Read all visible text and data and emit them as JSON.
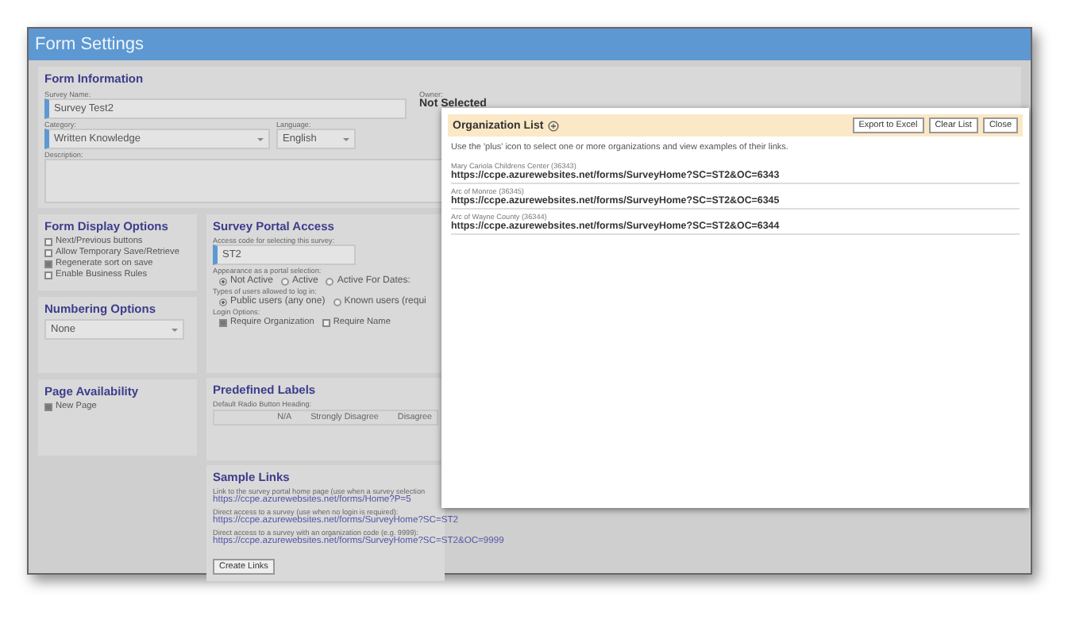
{
  "window": {
    "title": "Form Settings"
  },
  "form_information": {
    "heading": "Form Information",
    "survey_name": {
      "label": "Survey Name:",
      "value": "Survey Test2"
    },
    "owner": {
      "label": "Owner:",
      "value": "Not Selected"
    },
    "category": {
      "label": "Category:",
      "value": "Written Knowledge"
    },
    "language": {
      "label": "Language:",
      "value": "English"
    },
    "description": {
      "label": "Description:"
    }
  },
  "form_display_options": {
    "heading": "Form Display Options",
    "options": [
      {
        "label": "Next/Previous buttons",
        "checked": false
      },
      {
        "label": "Allow Temporary Save/Retrieve",
        "checked": false
      },
      {
        "label": "Regenerate sort on save",
        "checked": true
      },
      {
        "label": "Enable Business Rules",
        "checked": false
      }
    ]
  },
  "numbering_options": {
    "heading": "Numbering Options",
    "value": "None"
  },
  "page_availability": {
    "heading": "Page Availability",
    "options": [
      {
        "label": "New Page",
        "checked": true
      }
    ]
  },
  "survey_portal_access": {
    "heading": "Survey Portal Access",
    "access_code": {
      "label": "Access code for selecting this survey:",
      "value": "ST2"
    },
    "appearance": {
      "label": "Appearance as a portal selection:",
      "options": [
        {
          "label": "Not Active",
          "selected": true
        },
        {
          "label": "Active",
          "selected": false
        },
        {
          "label": "Active For Dates:",
          "selected": false
        }
      ]
    },
    "user_types": {
      "label": "Types of users allowed to log in:",
      "options": [
        {
          "label": "Public users (any one)",
          "selected": true
        },
        {
          "label": "Known users (requi",
          "selected": false
        }
      ]
    },
    "login_options": {
      "label": "Login Options:",
      "options": [
        {
          "label": "Require Organization",
          "checked": true
        },
        {
          "label": "Require Name",
          "checked": false
        }
      ]
    }
  },
  "predefined_labels": {
    "heading": "Predefined Labels",
    "label": "Default Radio Button Heading:",
    "columns": [
      "N/A",
      "Strongly Disagree",
      "Disagree"
    ]
  },
  "sample_links": {
    "heading": "Sample Links",
    "items": [
      {
        "description": "Link to the survey portal home page (use when a survey selection",
        "url": "https://ccpe.azurewebsites.net/forms/Home?P=5"
      },
      {
        "description": "Direct access to a survey (use when no login is required):",
        "url": "https://ccpe.azurewebsites.net/forms/SurveyHome?SC=ST2"
      },
      {
        "description": "Direct access to a survey with an organization code (e.g. 9999):",
        "url": "https://ccpe.azurewebsites.net/forms/SurveyHome?SC=ST2&OC=9999"
      }
    ],
    "button": "Create Links"
  },
  "organization_list": {
    "title": "Organization List",
    "buttons": [
      "Export to Excel",
      "Clear List",
      "Close"
    ],
    "instruction": "Use the 'plus' icon to select one or more organizations and view examples of their links.",
    "organizations": [
      {
        "name": "Mary Cariola Childrens Center (36343)",
        "url": "https://ccpe.azurewebsites.net/forms/SurveyHome?SC=ST2&OC=6343"
      },
      {
        "name": "Arc of Monroe (36345)",
        "url": "https://ccpe.azurewebsites.net/forms/SurveyHome?SC=ST2&OC=6345"
      },
      {
        "name": "Arc of Wayne County (36344)",
        "url": "https://ccpe.azurewebsites.net/forms/SurveyHome?SC=ST2&OC=6344"
      }
    ]
  }
}
